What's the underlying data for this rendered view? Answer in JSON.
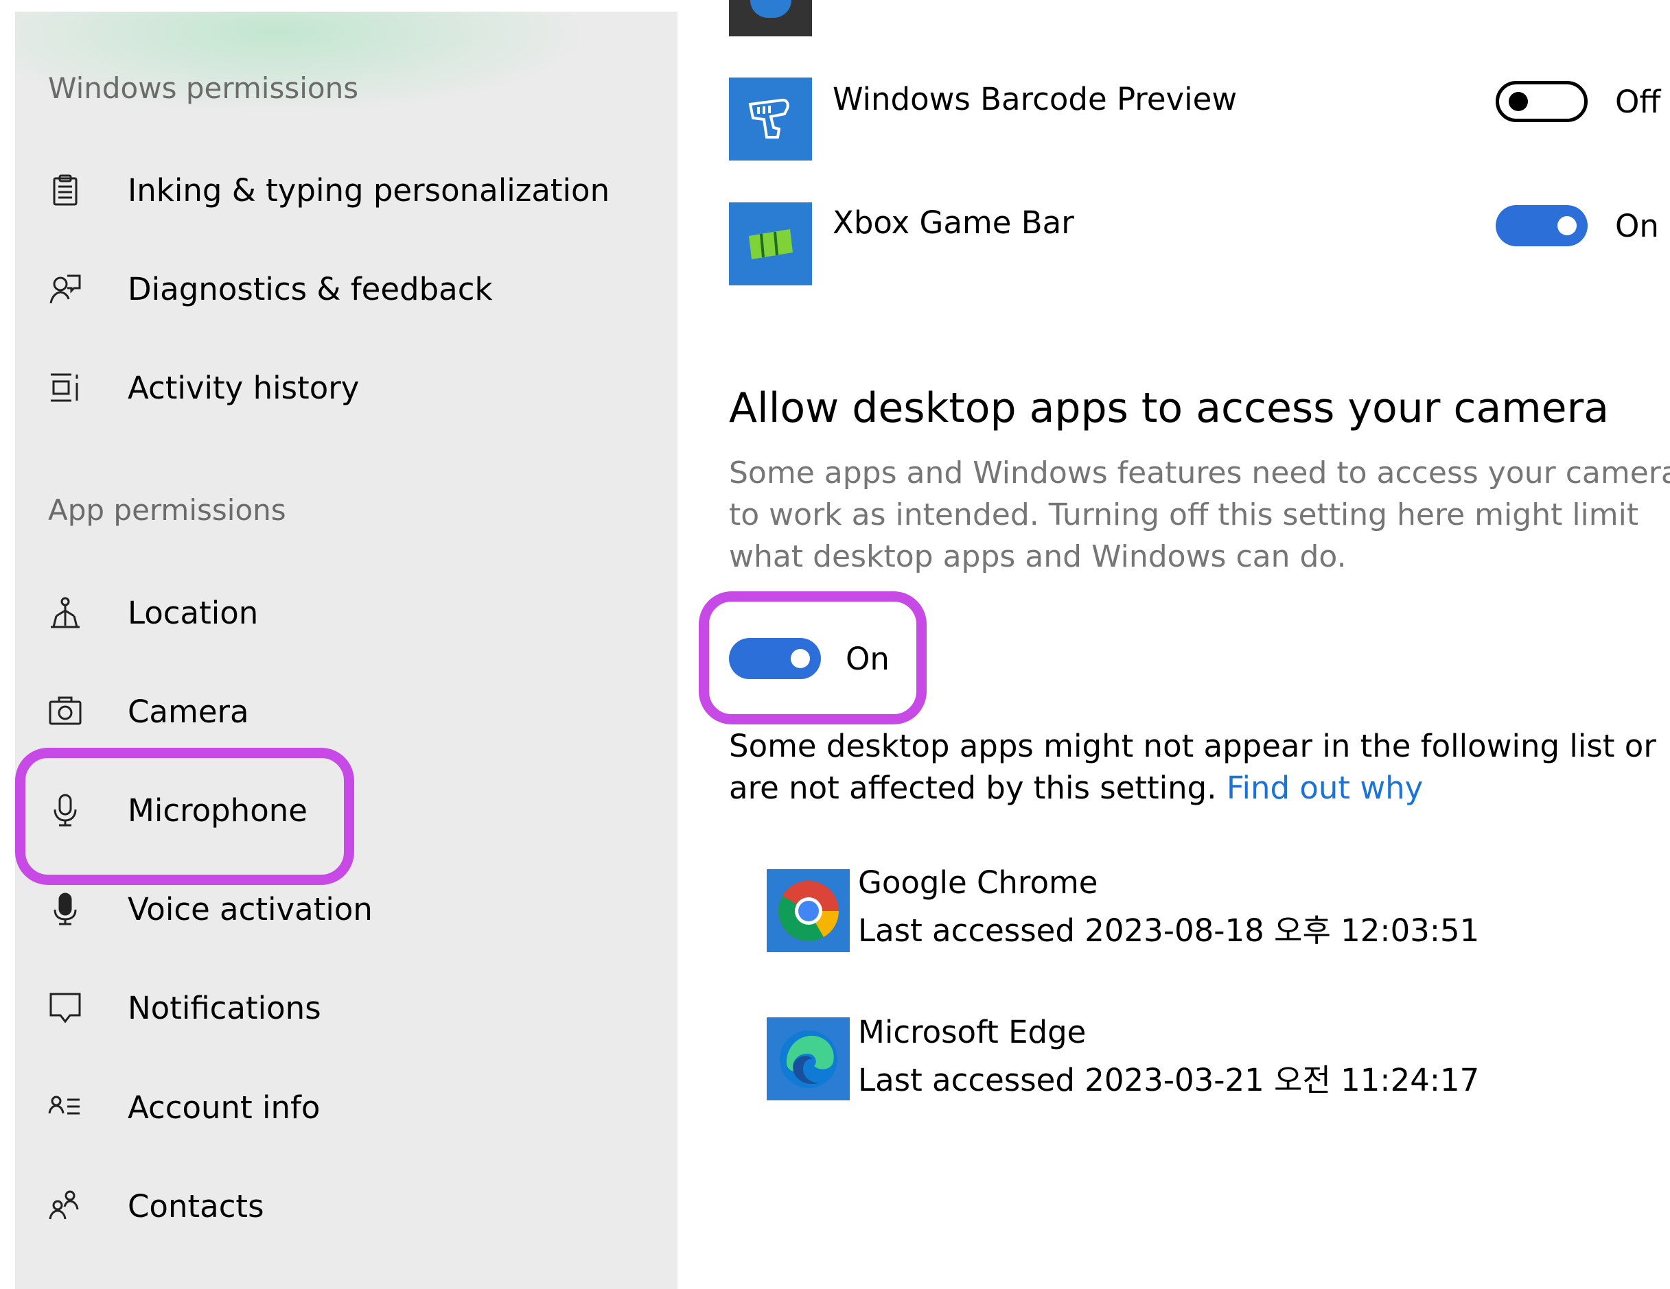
{
  "sidebar": {
    "windows_permissions_header": "Windows permissions",
    "windows_items": [
      {
        "label": "Inking & typing personalization",
        "icon": "clipboard-icon"
      },
      {
        "label": "Diagnostics & feedback",
        "icon": "person-feedback-icon"
      },
      {
        "label": "Activity history",
        "icon": "timeline-icon"
      }
    ],
    "app_permissions_header": "App permissions",
    "app_items": [
      {
        "label": "Location",
        "icon": "location-icon"
      },
      {
        "label": "Camera",
        "icon": "camera-icon"
      },
      {
        "label": "Microphone",
        "icon": "microphone-icon",
        "highlighted": true
      },
      {
        "label": "Voice activation",
        "icon": "voice-activation-icon"
      },
      {
        "label": "Notifications",
        "icon": "notification-icon"
      },
      {
        "label": "Account info",
        "icon": "account-info-icon"
      },
      {
        "label": "Contacts",
        "icon": "contacts-icon"
      }
    ]
  },
  "main": {
    "store_apps": [
      {
        "name": "Windows Barcode Preview",
        "toggle_label": "Off",
        "state": "off",
        "icon": "barcode-scanner-icon"
      },
      {
        "name": "Xbox Game Bar",
        "toggle_label": "On",
        "state": "on",
        "icon": "xbox-game-bar-icon"
      }
    ],
    "desktop_section": {
      "heading": "Allow desktop apps to access your camera",
      "description": "Some apps and Windows features need to access your camera to work as intended. Turning off this setting here might limit what desktop apps and Windows can do.",
      "toggle_label": "On",
      "toggle_state": "on",
      "note": "Some desktop apps might not appear in the following list or are not affected by this setting.",
      "link": "Find out why"
    },
    "desktop_apps": [
      {
        "name": "Google Chrome",
        "last_accessed": "Last accessed 2023-08-18 오후 12:03:51",
        "icon": "chrome-icon"
      },
      {
        "name": "Microsoft Edge",
        "last_accessed": "Last accessed 2023-03-21 오전 11:24:17",
        "icon": "edge-icon"
      }
    ]
  },
  "colors": {
    "accent": "#2d6fd8",
    "highlight": "#c84ae6",
    "tile": "#2b7cd3",
    "link": "#1a73d9"
  }
}
